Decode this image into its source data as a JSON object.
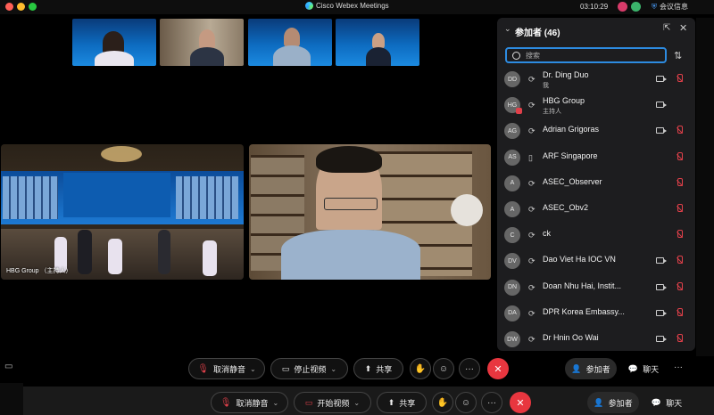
{
  "window": {
    "title": "Cisco Webex Meetings",
    "clock": "03:10:29",
    "meeting_info": "会议信息"
  },
  "stage": {
    "main_tile_name": "HBG Group （主持人）"
  },
  "panel": {
    "title": "参加者 (46)",
    "search_placeholder": "搜索",
    "participants": [
      {
        "initials": "DD",
        "name": "Dr. Ding Duo",
        "sub": "我",
        "camera": true,
        "muted": true
      },
      {
        "initials": "HG",
        "name": "HBG Group",
        "sub": "主持人",
        "camera": true,
        "muted": false
      },
      {
        "initials": "AG",
        "name": "Adrian Grigoras",
        "sub": "",
        "camera": true,
        "muted": true
      },
      {
        "initials": "AS",
        "name": "ARF Singapore",
        "sub": "",
        "camera": false,
        "muted": true
      },
      {
        "initials": "A",
        "name": "ASEC_Observer",
        "sub": "",
        "camera": false,
        "muted": true
      },
      {
        "initials": "A",
        "name": "ASEC_Obv2",
        "sub": "",
        "camera": false,
        "muted": true
      },
      {
        "initials": "C",
        "name": "ck",
        "sub": "",
        "camera": false,
        "muted": true
      },
      {
        "initials": "DV",
        "name": "Dao Viet Ha IOC VN",
        "sub": "",
        "camera": true,
        "muted": true
      },
      {
        "initials": "DN",
        "name": "Doan Nhu Hai, Instit...",
        "sub": "",
        "camera": true,
        "muted": true
      },
      {
        "initials": "DA",
        "name": "DPR Korea Embassy...",
        "sub": "",
        "camera": true,
        "muted": true
      },
      {
        "initials": "DW",
        "name": "Dr Hnin Oo Wai",
        "sub": "",
        "camera": true,
        "muted": true
      }
    ]
  },
  "controls": {
    "unmute": "取消静音",
    "stop_video": "停止视频",
    "share": "共享",
    "participants": "参加者",
    "chat": "聊天",
    "more": "···"
  },
  "controls_bottom": {
    "unmute": "取消静音",
    "start_video": "开始视频",
    "share": "共享",
    "participants": "参加者",
    "chat": "聊天",
    "more": "···"
  },
  "colors": {
    "accent": "#2d8be0",
    "end_call": "#e8363f",
    "muted": "#e0404a"
  }
}
